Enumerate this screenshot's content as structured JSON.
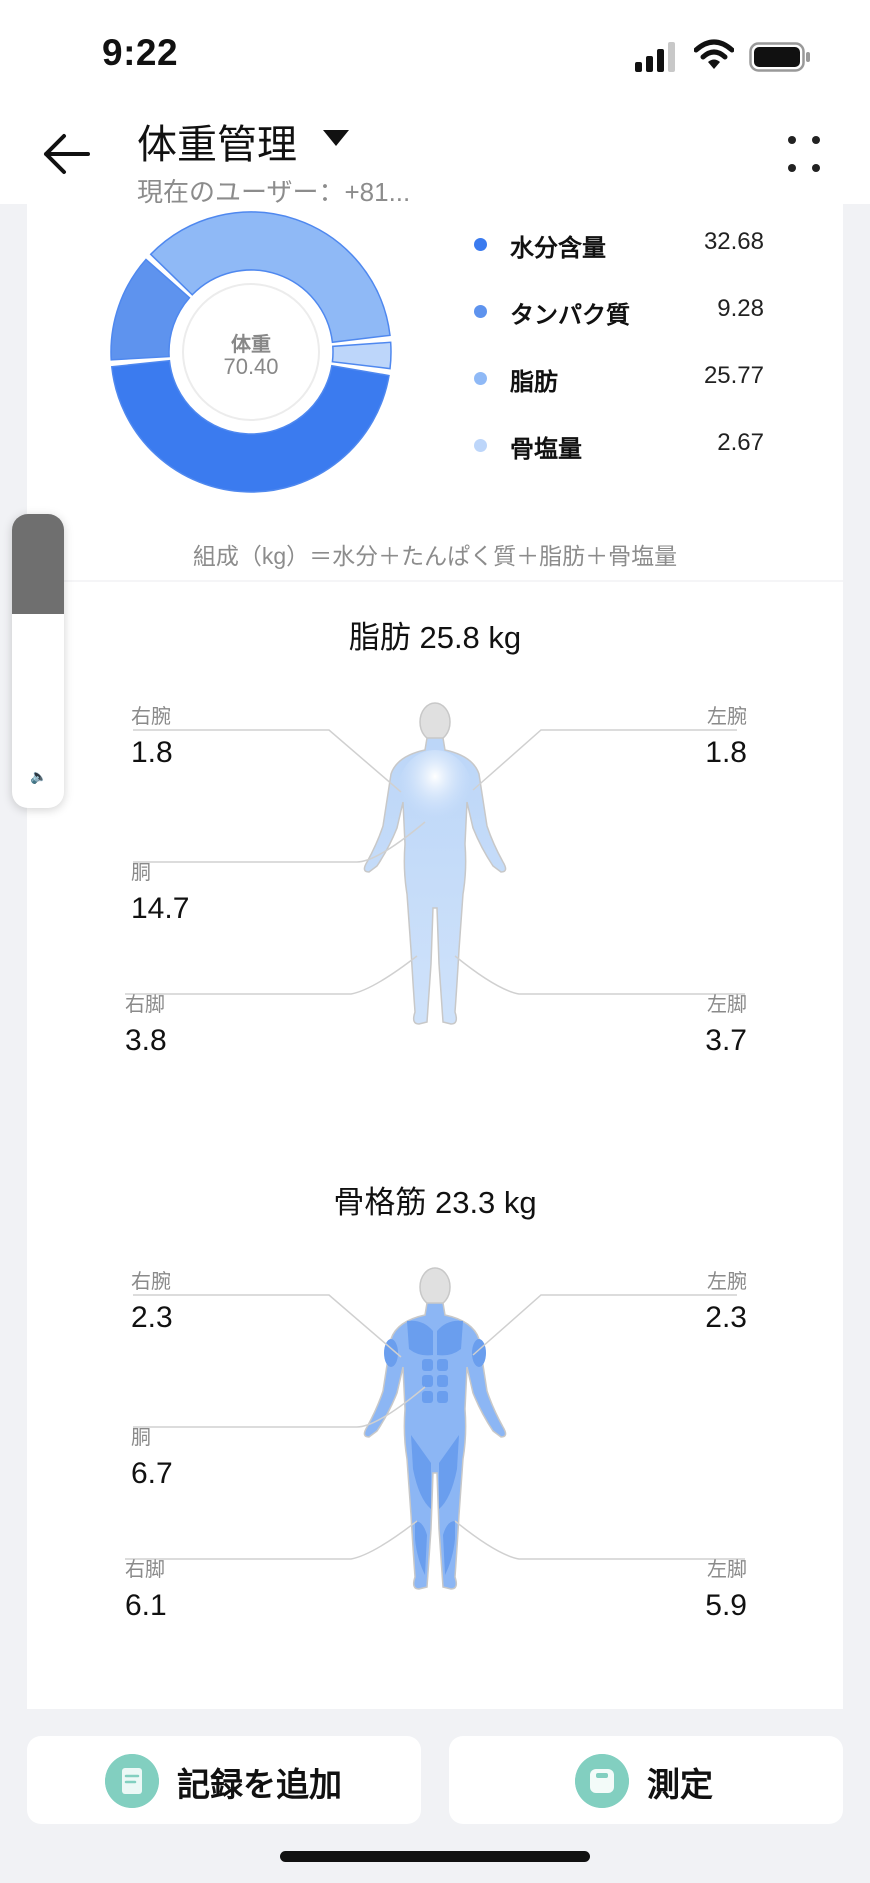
{
  "status": {
    "time": "9:22"
  },
  "header": {
    "title": "体重管理",
    "subtitle": "現在のユーザー：+81..."
  },
  "composition": {
    "center_title": "体重",
    "center_value": "70.40",
    "items": [
      {
        "name": "水分含量",
        "value": "32.68",
        "color": "#3b7bef"
      },
      {
        "name": "タンパク質",
        "value": "9.28",
        "color": "#5e93ee"
      },
      {
        "name": "脂肪",
        "value": "25.77",
        "color": "#8fb9f6"
      },
      {
        "name": "骨塩量",
        "value": "2.67",
        "color": "#bdd6fa"
      }
    ],
    "formula": "組成（kg）＝水分＋たんぱく質＋脂肪＋骨塩量"
  },
  "fat": {
    "title": "脂肪 25.8 kg",
    "right_arm": {
      "label": "右腕",
      "value": "1.8"
    },
    "left_arm": {
      "label": "左腕",
      "value": "1.8"
    },
    "trunk": {
      "label": "胴",
      "value": "14.7"
    },
    "right_leg": {
      "label": "右脚",
      "value": "3.8"
    },
    "left_leg": {
      "label": "左脚",
      "value": "3.7"
    }
  },
  "muscle": {
    "title": "骨格筋 23.3 kg",
    "right_arm": {
      "label": "右腕",
      "value": "2.3"
    },
    "left_arm": {
      "label": "左腕",
      "value": "2.3"
    },
    "trunk": {
      "label": "胴",
      "value": "6.7"
    },
    "right_leg": {
      "label": "右脚",
      "value": "6.1"
    },
    "left_leg": {
      "label": "左脚",
      "value": "5.9"
    }
  },
  "buttons": {
    "add_record": "記録を追加",
    "measure": "測定"
  },
  "volume": {
    "level": 0.34
  }
}
